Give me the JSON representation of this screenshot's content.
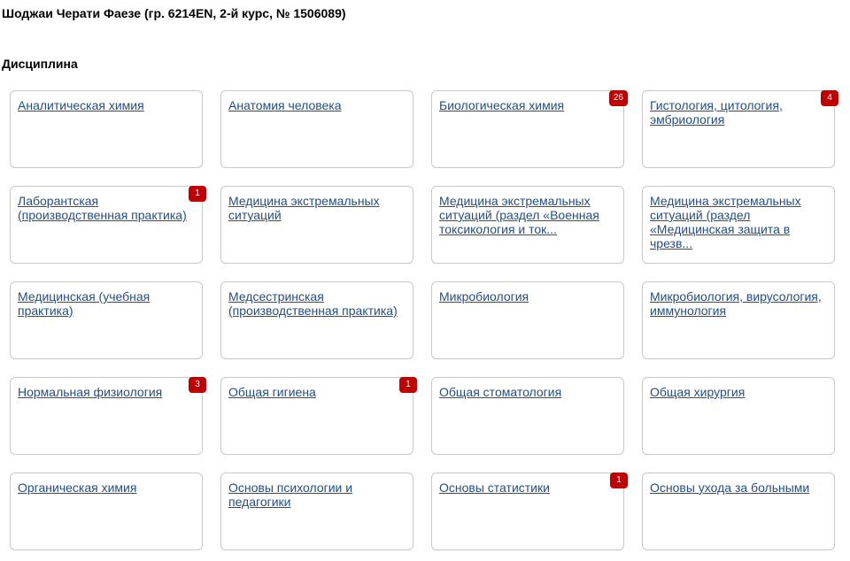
{
  "student": {
    "name": "Шоджаи Черати Фаезе (гр. 6214EN, 2-й курс, № 1506089)"
  },
  "section": {
    "title": "Дисциплина"
  },
  "colors": {
    "link": "#1f4e8a",
    "badge": "#c00000",
    "card_border": "#c8c8c8"
  },
  "disciplines": [
    {
      "label": "Аналитическая химия",
      "badge": ""
    },
    {
      "label": "Анатомия человека",
      "badge": ""
    },
    {
      "label": "Биологическая химия",
      "badge": "26"
    },
    {
      "label": "Гистология, цитология, эмбриология",
      "badge": "4"
    },
    {
      "label": "Лаборантская (производственная практика)",
      "badge": "1"
    },
    {
      "label": "Медицина экстремальных ситуаций",
      "badge": ""
    },
    {
      "label": "Медицина экстремальных ситуаций (раздел «Военная токсикология и ток...",
      "badge": ""
    },
    {
      "label": "Медицина экстремальных ситуаций (раздел «Медицинская защита в чрезв...",
      "badge": ""
    },
    {
      "label": "Медицинская (учебная практика)",
      "badge": ""
    },
    {
      "label": "Медсестринская (производственная практика)",
      "badge": ""
    },
    {
      "label": "Микробиология",
      "badge": ""
    },
    {
      "label": "Микробиология, вирусология, иммунология",
      "badge": ""
    },
    {
      "label": "Нормальная физиология",
      "badge": "3"
    },
    {
      "label": "Общая гигиена",
      "badge": "1"
    },
    {
      "label": "Общая стоматология",
      "badge": ""
    },
    {
      "label": "Общая хирургия",
      "badge": ""
    },
    {
      "label": "Органическая химия",
      "badge": ""
    },
    {
      "label": "Основы психологии и педагогики",
      "badge": ""
    },
    {
      "label": "Основы статистики",
      "badge": "1"
    },
    {
      "label": "Основы ухода за больными",
      "badge": ""
    }
  ]
}
